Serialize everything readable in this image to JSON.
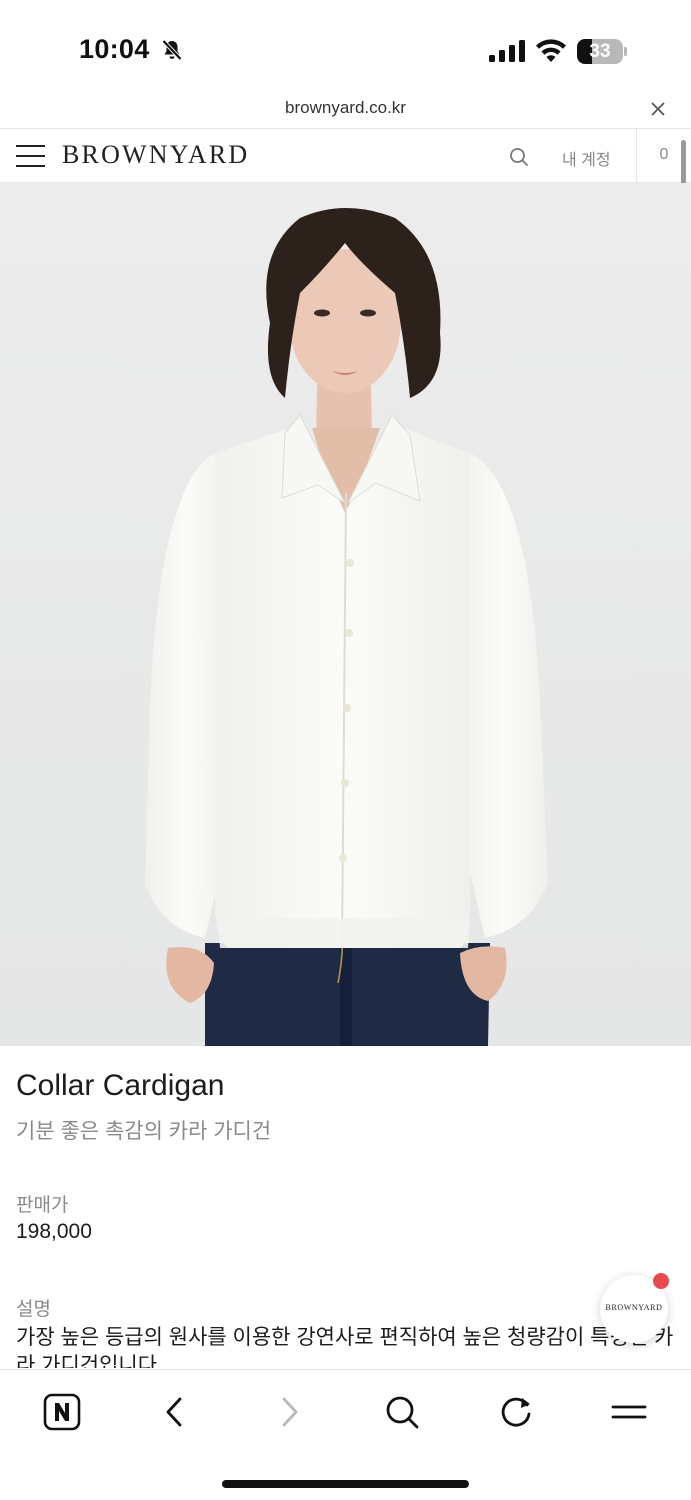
{
  "status_bar": {
    "time": "10:04",
    "battery_percent": "33",
    "battery_level": 0.33
  },
  "browser": {
    "url": "brownyard.co.kr"
  },
  "site_header": {
    "logo": "BROWNYARD",
    "account_label": "내 계정",
    "cart_count": "0"
  },
  "product": {
    "image_icon": "product-photo",
    "name": "Collar Cardigan",
    "subtitle": "기분 좋은 촉감의 카라 가디건",
    "price_label": "판매가",
    "price": "198,000",
    "description_label": "설명",
    "description": "가장 높은 등급의 원사를 이용한 강연사로 편직하여 높은 청량감이 특징인 카라 가디건입니다."
  },
  "floating_button": {
    "label": "BROWNYARD",
    "notification_color": "#e84a4f"
  },
  "bottom_toolbar": {
    "items": [
      "naver-home-icon",
      "back-icon",
      "forward-icon",
      "search-icon",
      "reload-icon",
      "menu-icon"
    ]
  }
}
